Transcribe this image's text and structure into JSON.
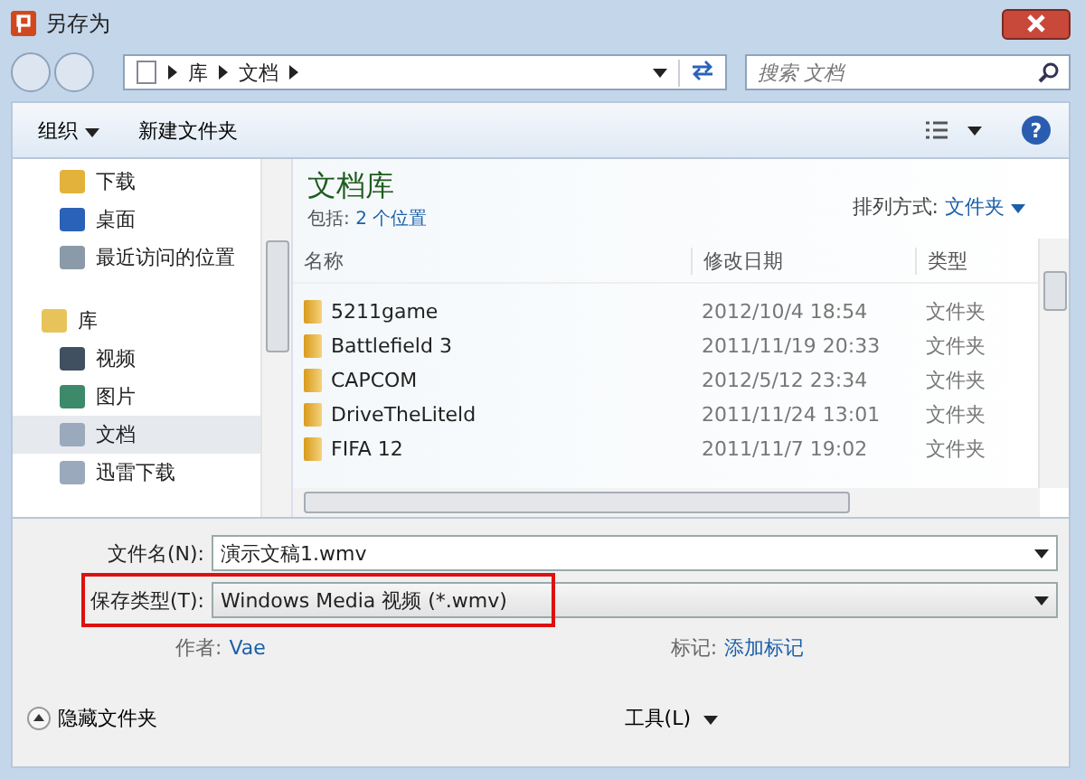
{
  "window": {
    "title": "另存为"
  },
  "address": {
    "crumbs": [
      "库",
      "文档"
    ],
    "search_placeholder": "搜索 文档"
  },
  "toolbar": {
    "organize": "组织",
    "new_folder": "新建文件夹",
    "help": "?"
  },
  "sidebar": {
    "items": [
      {
        "label": "下载",
        "kind": "item",
        "selected": false
      },
      {
        "label": "桌面",
        "kind": "item",
        "selected": false
      },
      {
        "label": "最近访问的位置",
        "kind": "item",
        "selected": false
      },
      {
        "label": "库",
        "kind": "group",
        "selected": false
      },
      {
        "label": "视频",
        "kind": "item",
        "selected": false
      },
      {
        "label": "图片",
        "kind": "item",
        "selected": false
      },
      {
        "label": "文档",
        "kind": "item",
        "selected": true
      },
      {
        "label": "迅雷下载",
        "kind": "item",
        "selected": false
      }
    ]
  },
  "library": {
    "title": "文档库",
    "includes_label": "包括:",
    "includes_link": "2 个位置",
    "sort_label": "排列方式:",
    "sort_value": "文件夹"
  },
  "table": {
    "columns": [
      "名称",
      "修改日期",
      "类型"
    ],
    "rows": [
      [
        "5211game",
        "2012/10/4 18:54",
        "文件夹"
      ],
      [
        "Battlefield 3",
        "2011/11/19 20:33",
        "文件夹"
      ],
      [
        "CAPCOM",
        "2012/5/12 23:34",
        "文件夹"
      ],
      [
        "DriveTheLiteld",
        "2011/11/24 13:01",
        "文件夹"
      ],
      [
        "FIFA 12",
        "2011/11/7 19:02",
        "文件夹"
      ]
    ]
  },
  "form": {
    "filename_label": "文件名(N):",
    "filename": "演示文稿1.wmv",
    "type_label": "保存类型(T):",
    "type": "Windows Media 视频 (*.wmv)",
    "type_highlighted": true,
    "author_label": "作者:",
    "author": "Vae",
    "tags_label": "标记:",
    "tags": "添加标记"
  },
  "footer": {
    "hide_folders": "隐藏文件夹",
    "tools": "工具(L)"
  }
}
